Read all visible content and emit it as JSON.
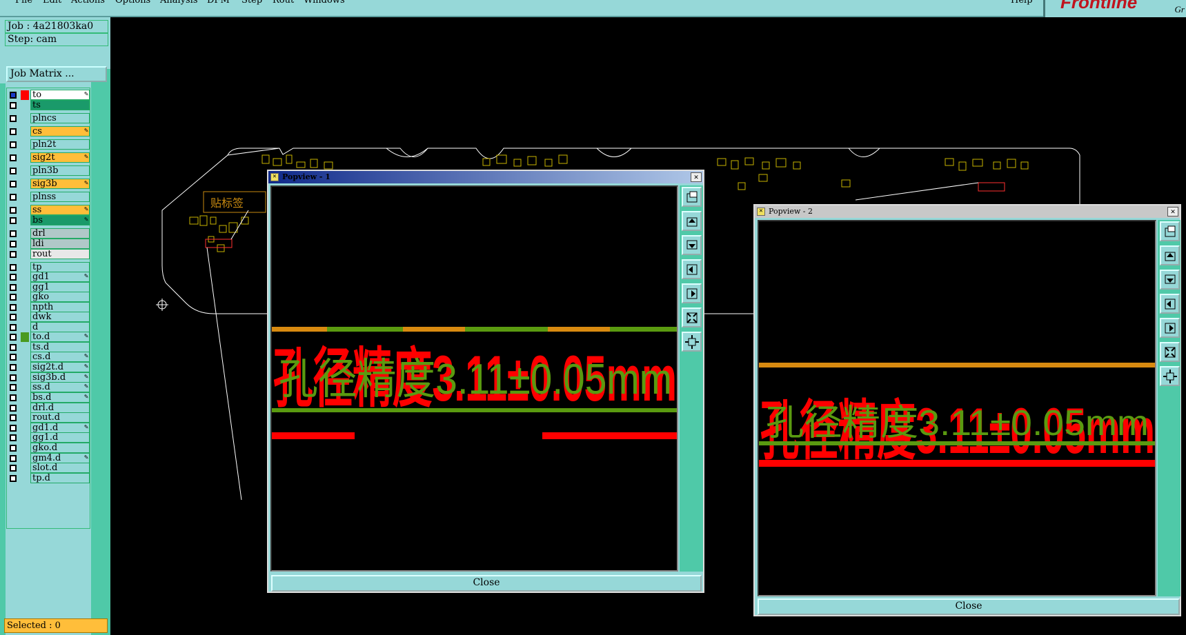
{
  "menu": {
    "items": [
      "File",
      "Edit",
      "Actions",
      "Options",
      "Analysis",
      "DFM",
      "Step",
      "Rout",
      "Windows"
    ],
    "help": "Help"
  },
  "brand": {
    "name": "Frontline",
    "sub": "Gr"
  },
  "sidebar": {
    "job": "Job : 4a21803ka0",
    "step": "Step: cam",
    "job_matrix": "Job Matrix ...",
    "selected": "Selected : 0",
    "layers": [
      {
        "name": "to",
        "color": "#ffffff"
      },
      {
        "name": "ts",
        "color": "#1a9a6a"
      },
      {
        "name": "plncs",
        "color": "#96d8d8"
      },
      {
        "name": "cs",
        "color": "#ffbe3a"
      },
      {
        "name": "pln2t",
        "color": "#96d8d8"
      },
      {
        "name": "sig2t",
        "color": "#ffbe3a"
      },
      {
        "name": "pln3b",
        "color": "#96d8d8"
      },
      {
        "name": "sig3b",
        "color": "#ffbe3a"
      },
      {
        "name": "plnss",
        "color": "#96d8d8"
      },
      {
        "name": "ss",
        "color": "#ffbe3a"
      },
      {
        "name": "bs",
        "color": "#1a9a6a"
      },
      {
        "name": "drl",
        "color": "#b0c8c8"
      },
      {
        "name": "ldi",
        "color": "#b0c8c8"
      },
      {
        "name": "rout",
        "color": "#e8e8e8"
      },
      {
        "name": "tp",
        "color": "#96d8d8"
      },
      {
        "name": "gd1",
        "color": "#96d8d8"
      },
      {
        "name": "gg1",
        "color": "#96d8d8"
      },
      {
        "name": "gko",
        "color": "#96d8d8"
      },
      {
        "name": "npth",
        "color": "#96d8d8"
      },
      {
        "name": "dwk",
        "color": "#96d8d8"
      },
      {
        "name": "d",
        "color": "#96d8d8"
      },
      {
        "name": "to.d",
        "color": "#96d8d8"
      },
      {
        "name": "ts.d",
        "color": "#96d8d8"
      },
      {
        "name": "cs.d",
        "color": "#96d8d8"
      },
      {
        "name": "sig2t.d",
        "color": "#96d8d8"
      },
      {
        "name": "sig3b.d",
        "color": "#96d8d8"
      },
      {
        "name": "ss.d",
        "color": "#96d8d8"
      },
      {
        "name": "bs.d",
        "color": "#96d8d8"
      },
      {
        "name": "drl.d",
        "color": "#96d8d8"
      },
      {
        "name": "rout.d",
        "color": "#96d8d8"
      },
      {
        "name": "gd1.d",
        "color": "#96d8d8"
      },
      {
        "name": "gg1.d",
        "color": "#96d8d8"
      },
      {
        "name": "gko.d",
        "color": "#96d8d8"
      },
      {
        "name": "gm4.d",
        "color": "#96d8d8"
      },
      {
        "name": "slot.d",
        "color": "#96d8d8"
      },
      {
        "name": "tp.d",
        "color": "#96d8d8"
      }
    ]
  },
  "board": {
    "label": "贴标签"
  },
  "popup1": {
    "title": "Popview - 1",
    "text": "孔径精度3.11±0.05mm",
    "close": "Close"
  },
  "popup2": {
    "title": "Popview - 2",
    "text": "孔径精度3.11±0.05mm",
    "close": "Close"
  },
  "colors": {
    "teal": "#96d8d8",
    "green": "#4fc9a8",
    "orange": "#ffbe3a",
    "red": "#ff0000",
    "trace_green": "#5a9a10",
    "trace_orange": "#d88a10"
  }
}
